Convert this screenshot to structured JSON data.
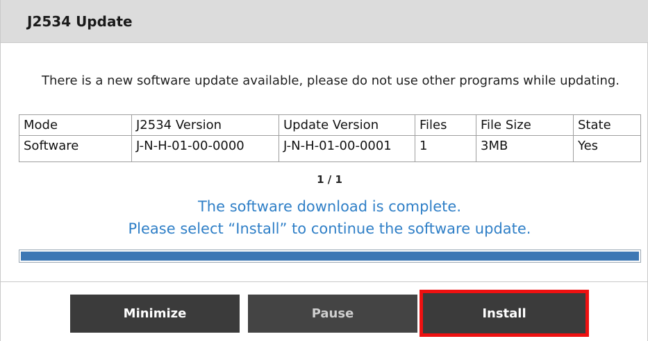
{
  "window": {
    "title": "J2534 Update"
  },
  "message": "There is a new software update available, please do not use other programs  while updating.",
  "table": {
    "headers": [
      "Mode",
      "J2534 Version",
      "Update Version",
      "Files",
      "File Size",
      "State"
    ],
    "rows": [
      [
        "Software",
        "J-N-H-01-00-0000",
        "J-N-H-01-00-0001",
        "1",
        "3MB",
        "Yes"
      ]
    ]
  },
  "pager": "1 / 1",
  "status": {
    "line1": "The software download is complete.",
    "line2": "Please select “Install”  to continue the software update."
  },
  "progress": {
    "fraction": 1.0,
    "color": "#3d77b4"
  },
  "buttons": {
    "minimize": "Minimize",
    "pause": "Pause",
    "install": "Install"
  },
  "colors": {
    "status_text": "#2f7fc7",
    "highlight": "#ee1111"
  }
}
